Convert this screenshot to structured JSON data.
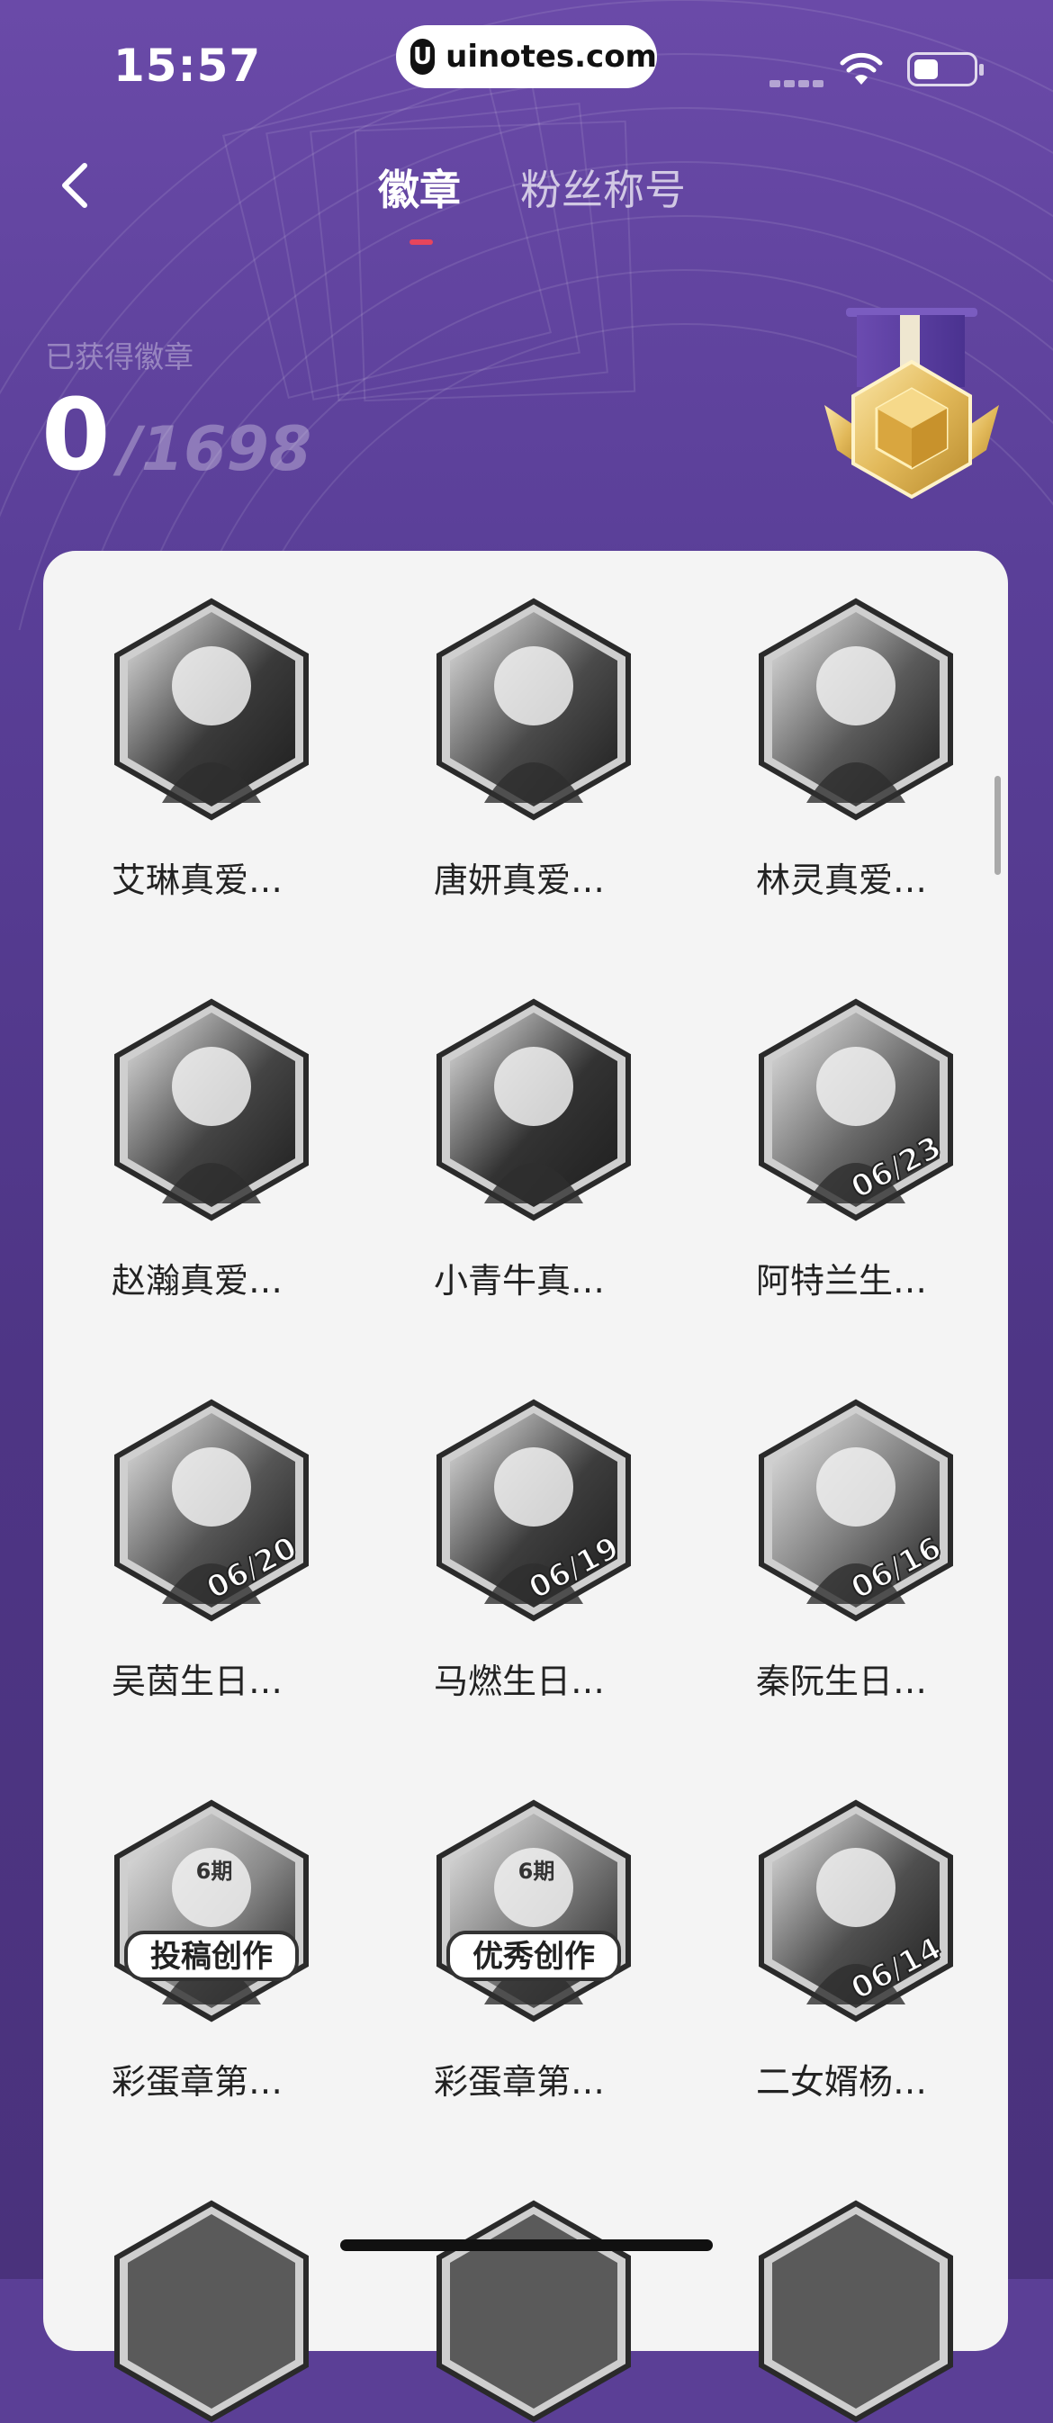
{
  "status_bar": {
    "time": "15:57",
    "url": "uinotes.com",
    "url_logo": "U"
  },
  "nav": {
    "tabs": [
      {
        "label": "徽章",
        "active": true
      },
      {
        "label": "粉丝称号",
        "active": false
      }
    ],
    "accent": "#e8455c"
  },
  "header": {
    "earned_label": "已获得徽章",
    "earned_count": "0",
    "total": "/1698"
  },
  "badges": [
    {
      "name": "艾琳真爱…"
    },
    {
      "name": "唐妍真爱…"
    },
    {
      "name": "林灵真爱…"
    },
    {
      "name": "赵瀚真爱…"
    },
    {
      "name": "小青牛真…"
    },
    {
      "name": "阿特兰生…",
      "date": "06/23"
    },
    {
      "name": "吴茵生日…",
      "date": "06/20"
    },
    {
      "name": "马燃生日…",
      "date": "06/19"
    },
    {
      "name": "秦阮生日…",
      "date": "06/16"
    },
    {
      "name": "彩蛋章第…",
      "period": "6期",
      "banner": "投稿创作"
    },
    {
      "name": "彩蛋章第…",
      "period": "6期",
      "banner": "优秀创作"
    },
    {
      "name": "二女婿杨…",
      "date": "06/14"
    }
  ],
  "colors": {
    "background": "#5a3f98",
    "card": "#f4f4f4",
    "medal_gold": "#e6c36a"
  }
}
